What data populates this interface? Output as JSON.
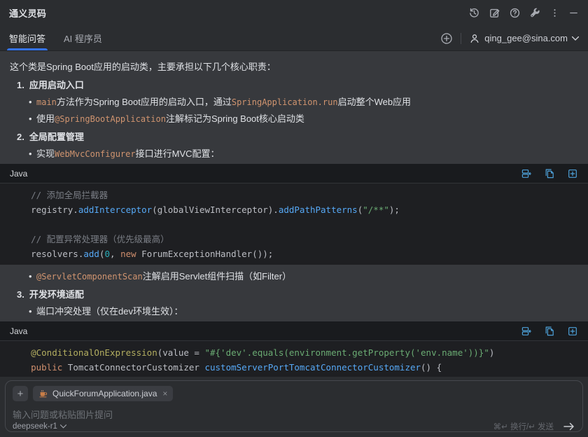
{
  "titlebar": {
    "title": "通义灵码",
    "icons": [
      "history-icon",
      "new-chat-icon",
      "help-icon",
      "settings-wrench-icon",
      "more-icon",
      "minimize-icon"
    ]
  },
  "tabs": {
    "items": [
      {
        "label": "智能问答",
        "active": true
      },
      {
        "label": "AI 程序员",
        "active": false
      }
    ],
    "new_session_icon": "plus-circle-icon"
  },
  "account": {
    "email": "qing_gee@sina.com",
    "icon": "user-icon",
    "caret": "chevron-down-icon"
  },
  "colors": {
    "accent": "#3574F0",
    "panel_bg": "#2B2D30",
    "content_bg": "#37393D",
    "code_bg": "#1E1F22",
    "code_icon_blue": "#4DA1D9",
    "inline_code_orange": "#D0946F",
    "string_green": "#6AAB73",
    "method_blue": "#56A8F5",
    "keyword_orange": "#CF8E6D",
    "comment_gray": "#7A7E85",
    "annotation_yellow": "#B3AE60",
    "number_teal": "#2AACB8",
    "java_icon_orange": "#C77D48"
  },
  "code_actions": [
    "insert-code-button",
    "copy-code-button",
    "insert-new-file-button"
  ],
  "chat": {
    "blocks": [
      {
        "type": "p",
        "segs": [
          {
            "t": "这个类是Spring Boot应用的启动类，主要承担以下几个核心职责："
          }
        ]
      },
      {
        "type": "num",
        "n": "1.",
        "title": "应用启动入口"
      },
      {
        "type": "bullet",
        "segs": [
          {
            "t": "main",
            "c": "code"
          },
          {
            "t": "方法作为Spring Boot应用的启动入口，通过"
          },
          {
            "t": "SpringApplication.run",
            "c": "code"
          },
          {
            "t": "启动整个Web应用"
          }
        ]
      },
      {
        "type": "bullet",
        "segs": [
          {
            "t": "使用"
          },
          {
            "t": "@SpringBootApplication",
            "c": "code"
          },
          {
            "t": "注解标记为Spring Boot核心启动类"
          }
        ]
      },
      {
        "type": "num",
        "n": "2.",
        "title": "全局配置管理"
      },
      {
        "type": "bullet",
        "segs": [
          {
            "t": "实现"
          },
          {
            "t": "WebMvcConfigurer",
            "c": "code"
          },
          {
            "t": "接口进行MVC配置："
          }
        ]
      },
      {
        "type": "codeblock",
        "lang": "Java",
        "lines": [
          [
            {
              "t": "    // 添加全局拦截器",
              "c": "cmt"
            }
          ],
          [
            {
              "t": "    registry."
            },
            {
              "t": "addInterceptor",
              "c": "m"
            },
            {
              "t": "(globalViewInterceptor)."
            },
            {
              "t": "addPathPatterns",
              "c": "m"
            },
            {
              "t": "("
            },
            {
              "t": "\"/**\"",
              "c": "s"
            },
            {
              "t": ");"
            }
          ],
          [
            {
              "t": ""
            }
          ],
          [
            {
              "t": "    // 配置异常处理器（优先级最高）",
              "c": "cmt"
            }
          ],
          [
            {
              "t": "    resolvers."
            },
            {
              "t": "add",
              "c": "m"
            },
            {
              "t": "("
            },
            {
              "t": "0",
              "c": "n"
            },
            {
              "t": ", "
            },
            {
              "t": "new ",
              "c": "k"
            },
            {
              "t": "ForumExceptionHandler());"
            }
          ]
        ]
      },
      {
        "type": "bullet",
        "segs": [
          {
            "t": "@ServletComponentScan",
            "c": "code"
          },
          {
            "t": "注解启用Servlet组件扫描（如Filter）"
          }
        ]
      },
      {
        "type": "num",
        "n": "3.",
        "title": "开发环境适配"
      },
      {
        "type": "bullet",
        "segs": [
          {
            "t": "端口冲突处理（仅在dev环境生效）："
          }
        ]
      },
      {
        "type": "codeblock",
        "lang": "Java",
        "lines": [
          [
            {
              "t": "    "
            },
            {
              "t": "@ConditionalOnExpression",
              "c": "a"
            },
            {
              "t": "(value = "
            },
            {
              "t": "\"#{'dev'.equals(environment.getProperty('env.name'))}\"",
              "c": "s"
            },
            {
              "t": ")"
            }
          ],
          [
            {
              "t": "    "
            },
            {
              "t": "public ",
              "c": "k"
            },
            {
              "t": "TomcatConnectorCustomizer "
            },
            {
              "t": "customServerPortTomcatConnectorCustomizer",
              "c": "m"
            },
            {
              "t": "() {"
            }
          ]
        ]
      }
    ]
  },
  "composer": {
    "add_label": "+",
    "chip": {
      "icon": "java-coffee-icon",
      "file": "QuickForumApplication.java",
      "close": "×"
    },
    "placeholder": "输入问题或粘贴图片提问",
    "model": "deepseek-r1",
    "hint": "⌘↵ 换行/↵ 发送",
    "send_icon": "send-arrow-icon"
  }
}
